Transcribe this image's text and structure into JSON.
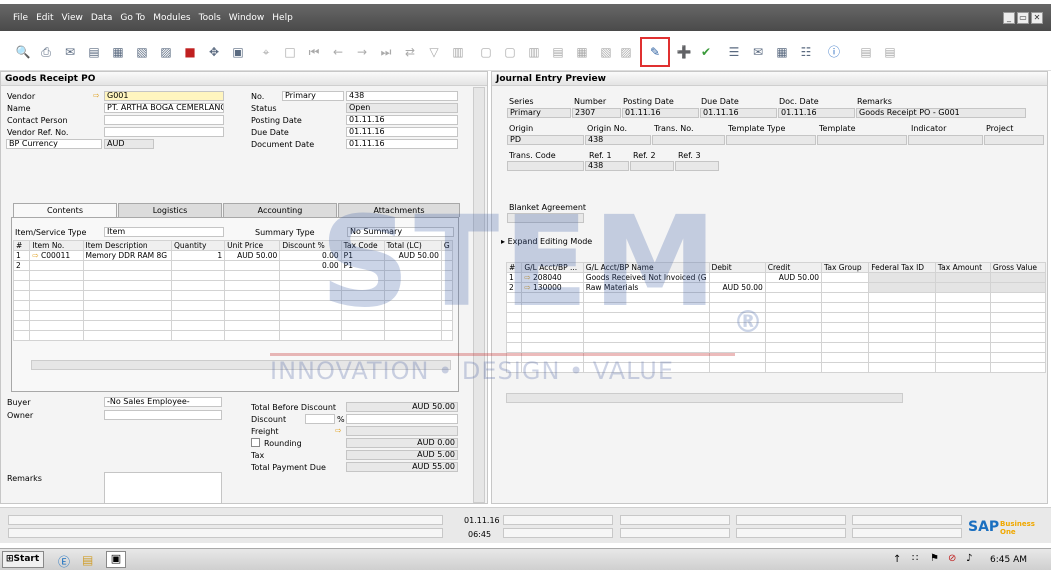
{
  "menu": [
    "File",
    "Edit",
    "View",
    "Data",
    "Go To",
    "Modules",
    "Tools",
    "Window",
    "Help"
  ],
  "window_controls": [
    "_",
    "▭",
    "✕"
  ],
  "left": {
    "title": "Goods Receipt PO",
    "vendor_label": "Vendor",
    "vendor": "G001",
    "name_label": "Name",
    "name": "PT. ARTHA BOGA CEMERLANG",
    "contact_label": "Contact Person",
    "vendor_ref_label": "Vendor Ref. No.",
    "currency_label": "BP Currency",
    "currency": "AUD",
    "no_label": "No.",
    "no_series": "Primary",
    "no_value": "438",
    "status_label": "Status",
    "status": "Open",
    "posting_label": "Posting Date",
    "posting": "01.11.16",
    "due_label": "Due Date",
    "due": "01.11.16",
    "docdate_label": "Document Date",
    "docdate": "01.11.16",
    "tabs": [
      "Contents",
      "Logistics",
      "Accounting",
      "Attachments"
    ],
    "item_type_label": "Item/Service Type",
    "item_type": "Item",
    "summary_label": "Summary Type",
    "summary": "No Summary",
    "columns": [
      "#",
      "Item No.",
      "Item Description",
      "Quantity",
      "Unit Price",
      "Discount %",
      "Tax Code",
      "Total (LC)",
      "G"
    ],
    "rows": [
      [
        "1",
        "C00011",
        "Memory DDR RAM 8G",
        "1",
        "AUD 50.00",
        "0.00",
        "P1",
        "AUD 50.00"
      ],
      [
        "2",
        "",
        "",
        "",
        "",
        "0.00",
        "P1",
        ""
      ]
    ],
    "buyer_label": "Buyer",
    "buyer": "-No Sales Employee-",
    "owner_label": "Owner",
    "remarks_label": "Remarks",
    "total_before_label": "Total Before Discount",
    "total_before": "AUD 50.00",
    "discount_label": "Discount",
    "discount_pct": "%",
    "freight_label": "Freight",
    "rounding_label": "Rounding",
    "rounding": "AUD 0.00",
    "tax_label": "Tax",
    "tax": "AUD 5.00",
    "total_due_label": "Total Payment Due",
    "total_due": "AUD 55.00"
  },
  "right": {
    "title": "Journal Entry Preview",
    "h1": [
      "Series",
      "Number",
      "Posting Date",
      "Due Date",
      "Doc. Date",
      "Remarks"
    ],
    "v1": [
      "Primary",
      "2307",
      "01.11.16",
      "01.11.16",
      "01.11.16",
      "Goods Receipt PO - G001"
    ],
    "h2": [
      "Origin",
      "Origin No.",
      "Trans. No.",
      "Template Type",
      "Template",
      "Indicator",
      "Project"
    ],
    "v2": [
      "PD",
      "438",
      "",
      "",
      "",
      "",
      ""
    ],
    "h3": [
      "Trans. Code",
      "Ref. 1",
      "Ref. 2",
      "Ref. 3"
    ],
    "v3": [
      "",
      "438",
      "",
      ""
    ],
    "blanket_label": "Blanket Agreement",
    "expand_label": "Expand Editing Mode",
    "columns": [
      "#",
      "G/L Acct/BP ...",
      "G/L Acct/BP Name",
      "Debit",
      "Credit",
      "Tax Group",
      "Federal Tax ID",
      "Tax Amount",
      "Gross Value"
    ],
    "rows": [
      [
        "1",
        "208040",
        "Goods Received Not Invoiced (G",
        "",
        "AUD 50.00",
        "",
        "",
        "",
        ""
      ],
      [
        "2",
        "130000",
        "Raw Materials",
        "AUD 50.00",
        "",
        "",
        "",
        "",
        ""
      ]
    ]
  },
  "statusbar": {
    "date": "01.11.16",
    "time": "06:45",
    "brand": "SAP",
    "brand_sub": "Business One"
  },
  "taskbar": {
    "start": "Start",
    "clock": "6:45 AM"
  },
  "watermark": {
    "main": "STEM",
    "reg": "®",
    "tagline": "INNOVATION • DESIGN • VALUE"
  },
  "colors": {
    "menubar": "#555555",
    "highlight": "#e03030",
    "watermark": "#4664aa",
    "sap_blue": "#1a6fc0",
    "sap_gold": "#f0a800"
  }
}
